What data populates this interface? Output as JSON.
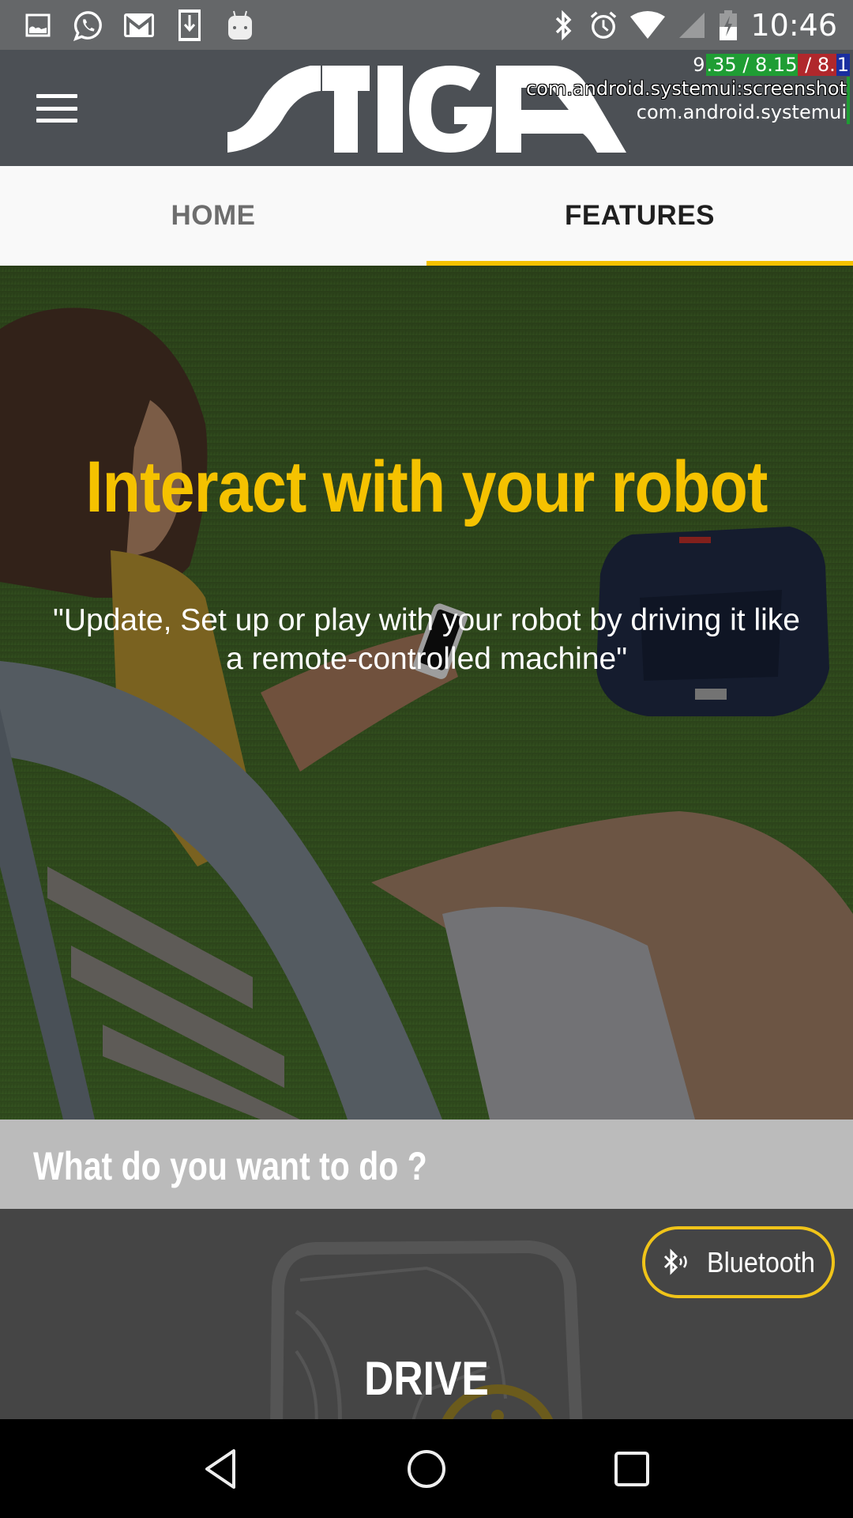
{
  "status_bar": {
    "left_icons": [
      "gallery-icon",
      "whatsapp-icon",
      "gmail-icon",
      "download-icon",
      "android-icon"
    ],
    "right_icons": [
      "bluetooth-icon",
      "alarm-icon",
      "wifi-icon",
      "cell-signal-icon",
      "battery-charging-icon"
    ],
    "time": "10:46"
  },
  "app_bar": {
    "menu_icon": "hamburger-menu-icon",
    "brand": "STIGA"
  },
  "debug_overlay": {
    "fps_a": "9",
    "fps_b": ".35 / 8.15",
    "fps_c": " / 8.",
    "fps_d": "1",
    "line2": "com.android.systemui:screenshot",
    "line3": "com.android.systemui"
  },
  "tabs": [
    {
      "label": "HOME",
      "active": false
    },
    {
      "label": "FEATURES",
      "active": true
    }
  ],
  "hero": {
    "title": "Interact with your robot",
    "subtitle": "\"Update, Set up or play with your robot by driving it like a remote-controlled machine\""
  },
  "question": {
    "text": "What do you want to do ?"
  },
  "drive_card": {
    "label": "DRIVE",
    "connection_button": {
      "label": "Bluetooth",
      "icon": "bluetooth-signal-icon"
    }
  },
  "nav_bar": {
    "buttons": [
      "back-icon",
      "home-icon",
      "recents-icon"
    ]
  },
  "colors": {
    "accent_yellow": "#f5c200",
    "app_bar": "#4c5055",
    "status_bar": "#656769",
    "question_bar": "#bbbbbb",
    "drive_bg": "#454545"
  }
}
